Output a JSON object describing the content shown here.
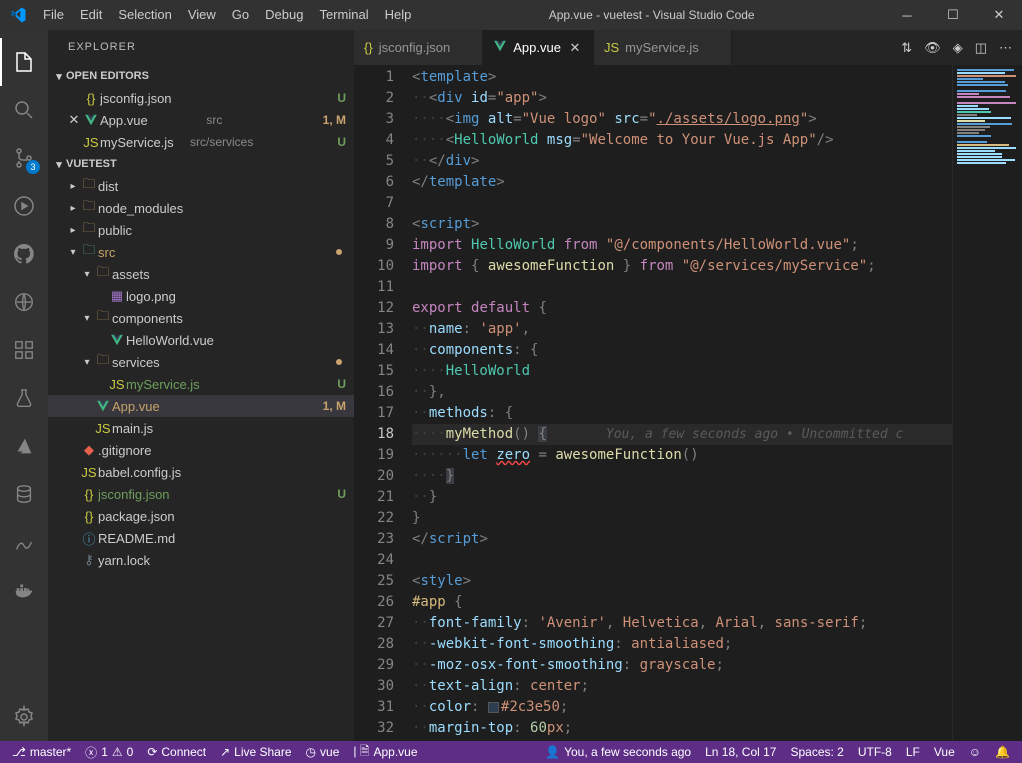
{
  "title": "App.vue - vuetest - Visual Studio Code",
  "menu": [
    "File",
    "Edit",
    "Selection",
    "View",
    "Go",
    "Debug",
    "Terminal",
    "Help"
  ],
  "activity": {
    "scm_badge": "3"
  },
  "sidebar": {
    "title": "EXPLORER",
    "open_editors_label": "OPEN EDITORS",
    "project_label": "VUETEST",
    "open_editors": [
      {
        "name": "jsconfig.json",
        "hint": "",
        "status": "U",
        "icon": "json"
      },
      {
        "name": "App.vue",
        "hint": "src",
        "status": "1, M",
        "icon": "vue",
        "modified": true,
        "close": true
      },
      {
        "name": "myService.js",
        "hint": "src/services",
        "status": "U",
        "icon": "js"
      }
    ],
    "tree": [
      {
        "d": 1,
        "tw": "▸",
        "icon": "folder",
        "name": "dist"
      },
      {
        "d": 1,
        "tw": "▸",
        "icon": "folder",
        "name": "node_modules"
      },
      {
        "d": 1,
        "tw": "▸",
        "icon": "folder",
        "name": "public"
      },
      {
        "d": 1,
        "tw": "▾",
        "icon": "folder-src",
        "name": "src",
        "dot": true,
        "cls": "src"
      },
      {
        "d": 2,
        "tw": "▾",
        "icon": "folder",
        "name": "assets"
      },
      {
        "d": 3,
        "tw": "",
        "icon": "img",
        "name": "logo.png"
      },
      {
        "d": 2,
        "tw": "▾",
        "icon": "folder",
        "name": "components"
      },
      {
        "d": 3,
        "tw": "",
        "icon": "vue",
        "name": "HelloWorld.vue"
      },
      {
        "d": 2,
        "tw": "▾",
        "icon": "folder",
        "name": "services",
        "dot": true
      },
      {
        "d": 3,
        "tw": "",
        "icon": "js",
        "name": "myService.js",
        "status": "U"
      },
      {
        "d": 2,
        "tw": "",
        "icon": "vue",
        "name": "App.vue",
        "status": "1, M",
        "sel": true
      },
      {
        "d": 2,
        "tw": "",
        "icon": "js",
        "name": "main.js"
      },
      {
        "d": 1,
        "tw": "",
        "icon": "git",
        "name": ".gitignore"
      },
      {
        "d": 1,
        "tw": "",
        "icon": "js",
        "name": "babel.config.js"
      },
      {
        "d": 1,
        "tw": "",
        "icon": "json",
        "name": "jsconfig.json",
        "status": "U"
      },
      {
        "d": 1,
        "tw": "",
        "icon": "json",
        "name": "package.json"
      },
      {
        "d": 1,
        "tw": "",
        "icon": "info",
        "name": "README.md"
      },
      {
        "d": 1,
        "tw": "",
        "icon": "lock",
        "name": "yarn.lock"
      }
    ]
  },
  "tabs": [
    {
      "name": "jsconfig.json",
      "icon": "json"
    },
    {
      "name": "App.vue",
      "icon": "vue",
      "active": true,
      "close": true
    },
    {
      "name": "myService.js",
      "icon": "js"
    }
  ],
  "blame": "You, a few seconds ago • Uncommitted c",
  "lines": 32,
  "current_line": 18,
  "status": {
    "branch": "master*",
    "errors": "1",
    "warnings": "0",
    "liveshare": "Live Share",
    "connect": "Connect",
    "lang_server": "vue",
    "file": "App.vue",
    "blame": "You, a few seconds ago",
    "pos": "Ln 18, Col 17",
    "spaces": "Spaces: 2",
    "enc": "UTF-8",
    "eol": "LF",
    "lang": "Vue"
  }
}
